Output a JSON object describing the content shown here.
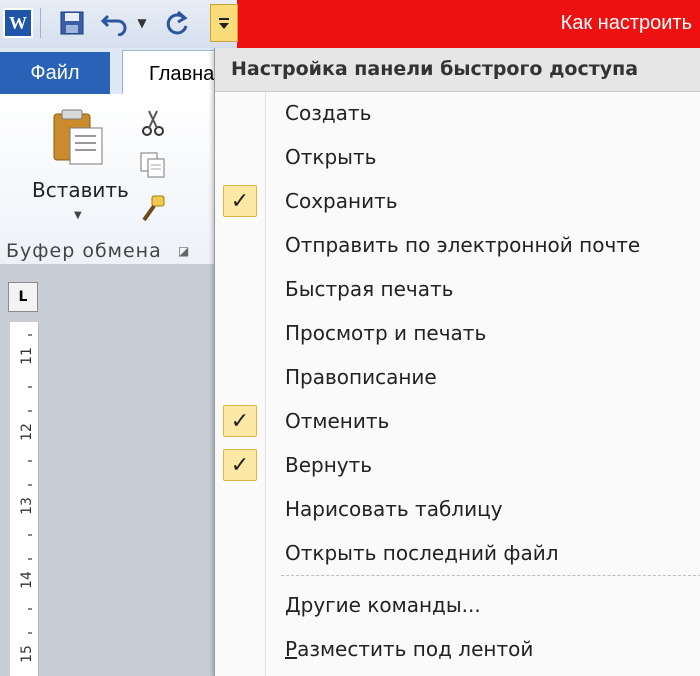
{
  "window": {
    "title": "Как настроить",
    "app_icon_letter": "W"
  },
  "qat": {
    "icons": [
      "word-logo-icon",
      "save-icon",
      "undo-icon",
      "dropdown-arrow-icon",
      "redo-icon",
      "customize-dropdown-icon"
    ]
  },
  "ribbon": {
    "file_tab": "Файл",
    "home_tab": "Главна",
    "paste_label": "Вставить",
    "group_label": "Буфер обмена"
  },
  "ruler": {
    "corner": "L",
    "numbers": [
      "11",
      "12",
      "13",
      "14",
      "15"
    ]
  },
  "menu": {
    "header": "Настройка панели быстрого доступа",
    "items": [
      {
        "label": "Создать",
        "checked": false
      },
      {
        "label": "Открыть",
        "checked": false
      },
      {
        "label": "Сохранить",
        "checked": true
      },
      {
        "label": "Отправить по электронной почте",
        "checked": false
      },
      {
        "label": "Быстрая печать",
        "checked": false
      },
      {
        "label": "Просмотр и печать",
        "checked": false
      },
      {
        "label": "Правописание",
        "checked": false
      },
      {
        "label": "Отменить",
        "checked": true
      },
      {
        "label": "Вернуть",
        "checked": true
      },
      {
        "label": "Нарисовать таблицу",
        "checked": false
      },
      {
        "label": "Открыть последний файл",
        "checked": false
      }
    ],
    "more_commands": "Другие команды...",
    "show_below": "Разместить под лентой",
    "check_glyph": "✓"
  },
  "colors": {
    "title_red": "#ee1111",
    "file_tab_blue": "#2a62b8",
    "check_highlight": "#fde8a6"
  }
}
